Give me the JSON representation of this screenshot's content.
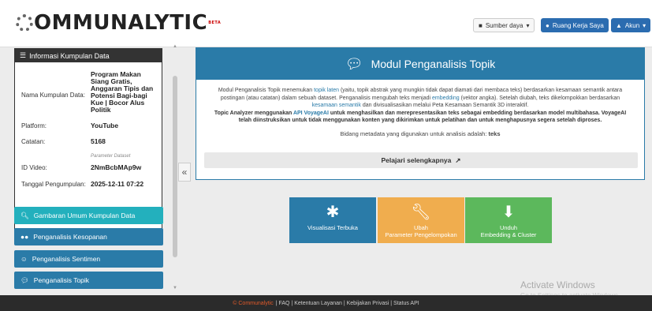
{
  "header": {
    "logo_text": "OMMUNALYTIC",
    "logo_sup": "BETA",
    "source_button": "Sumber daya",
    "workspace_button": "Ruang Kerja Saya",
    "account_button": "Akun"
  },
  "info": {
    "title": "Informasi Kumpulan Data",
    "dataset_label": "Nama Kumpulan Data:",
    "dataset_value": "Program Makan Siang Gratis, Anggaran Tipis dan Potensi Bagi-bagi Kue | Bocor Alus Politik",
    "platform_label": "Platform:",
    "platform_value": "YouTube",
    "notes_label": "Catatan:",
    "notes_value": "5168",
    "param_label": "Parameter Dataset",
    "video_label": "ID Video:",
    "video_value": "2NmBcbMAp9w",
    "date_label": "Tanggal Pengumpulan:",
    "date_value": "2025-12-11 07:22"
  },
  "sidebar": {
    "items": [
      {
        "label": "Gambaran Umum Kumpulan Data"
      },
      {
        "label": "Penganalisis Kesopanan"
      },
      {
        "label": "Penganalisis Sentimen"
      },
      {
        "label": "Penganalisis Topik"
      }
    ]
  },
  "module": {
    "title": "Modul Penganalisis Topik",
    "p1_a": "Modul Penganalisis Topik menemukan ",
    "p1_link1": "topik laten",
    "p1_b": " (yaitu, topik abstrak yang mungkin tidak dapat diamati dari membaca teks) berdasarkan kesamaan semantik antara postingan (atau catatan) dalam sebuah dataset. Penganalisis mengubah teks menjadi ",
    "p1_link2": "embedding",
    "p1_c": " (vektor angka). Setelah diubah, teks dikelompokkan berdasarkan ",
    "p1_link3": "kesamaan semantik",
    "p1_d": " dan divisualisasikan melalui Peta Kesamaan Semantik 3D interaktif.",
    "p2_a": "Topic Analyzer menggunakan ",
    "p2_link": "API VoyageAI",
    "p2_b": " untuk menghasilkan dan merepresentasikan teks sebagai embedding berdasarkan model multibahasa. VoyageAI telah diinstruksikan untuk tidak menggunakan konten yang dikirimkan untuk pelatihan dan untuk menghapusnya segera setelah diproses.",
    "meta": "Bidang metadata yang digunakan untuk analisis adalah: ",
    "meta_field": "teks",
    "learn_more": "Pelajari selengkapnya"
  },
  "tiles": {
    "visualize": "Visualisasi Terbuka",
    "params_l1": "Ubah",
    "params_l2": "Parameter Pengelompokan",
    "download_l1": "Unduh",
    "download_l2": "Embedding & Cluster"
  },
  "collapse": "«",
  "watermark": {
    "line1": "Activate Windows",
    "line2": "Go to Settings to activate Windows."
  },
  "footer": {
    "brand": "© Communalytic",
    "links": "| FAQ | Ketentuan Layanan | Kebijakan Privasi | Status API"
  },
  "colors": {
    "primary": "#2a7ba8",
    "active": "#23b0bd",
    "orange": "#f0ad4e",
    "green": "#5cb85c"
  }
}
